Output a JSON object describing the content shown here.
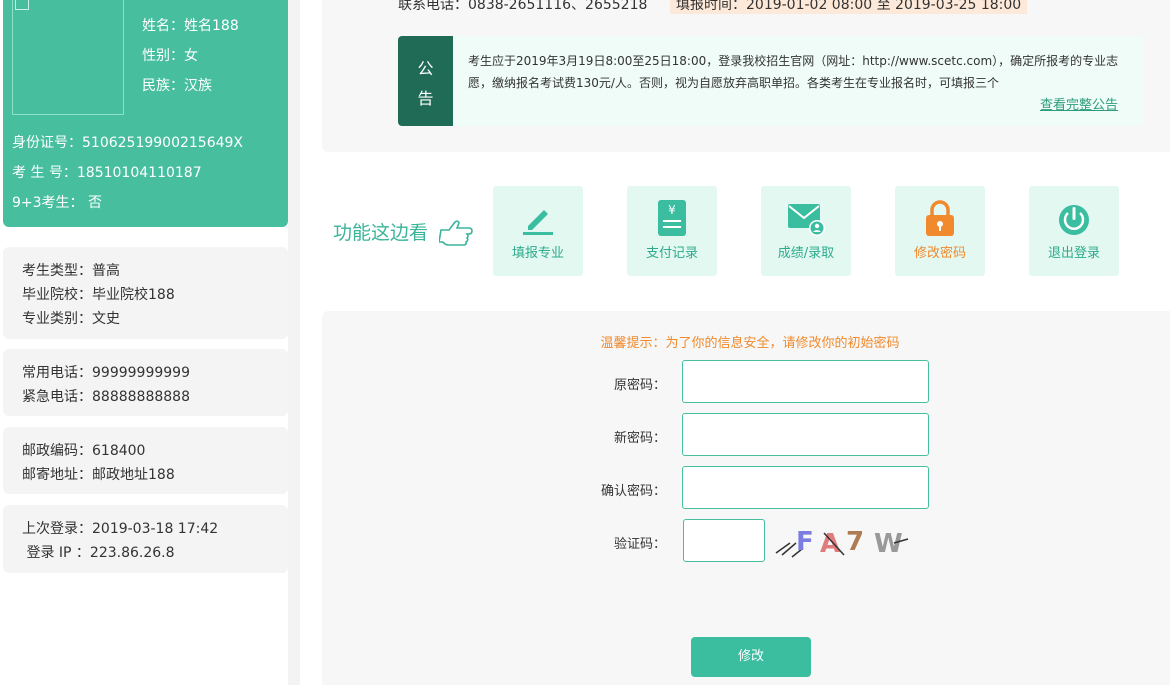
{
  "profile": {
    "name": "姓名：姓名188",
    "gender": "性别：女",
    "ethnicity": "民族：汉族",
    "id_number": "身份证号：51062519900215649X",
    "exam_number": "考 生 号：18510104110187",
    "nine_three": "9+3考生： 否"
  },
  "cards": {
    "exam_type": "考生类型：普高",
    "school": "毕业院校：毕业院校188",
    "category": "专业类别：文史",
    "phone": "常用电话：99999999999",
    "emergency": "紧急电话：88888888888",
    "postcode": "邮政编码：618400",
    "address": "邮寄地址：邮政地址188",
    "last_login": "上次登录：2019-03-18 17:42",
    "login_ip": " 登录 IP ：223.86.26.8"
  },
  "header": {
    "contact": "联系电话：0838-2651116、2655218",
    "fill_time": "填报时间：2019-01-02 08:00 至 2019-03-25 18:00"
  },
  "notice": {
    "tag_top": "公",
    "tag_bottom": "告",
    "text": "考生应于2019年3月19日8:00至25日18:00，登录我校招生官网（网址：http://www.scetc.com），确定所报考的专业志愿，缴纳报名考试费130元/人。否则，视为自愿放弃高职单招。各类考生在专业报名时，可填报三个",
    "link": "查看完整公告"
  },
  "functions": {
    "label": "功能这边看",
    "items": [
      {
        "label": "填报专业",
        "icon": "pencil-icon"
      },
      {
        "label": "支付记录",
        "icon": "receipt-icon"
      },
      {
        "label": "成绩/录取",
        "icon": "mail-user-icon"
      },
      {
        "label": "修改密码",
        "icon": "lock-icon"
      },
      {
        "label": "退出登录",
        "icon": "power-icon"
      }
    ]
  },
  "form": {
    "tip": "温馨提示：为了你的信息安全，请修改你的初始密码",
    "old_label": "原密码：",
    "new_label": "新密码：",
    "confirm_label": "确认密码：",
    "captcha_label": "验证码：",
    "captcha_text": "FA7W",
    "submit": "修改"
  },
  "colors": {
    "primary": "#47bf9f",
    "dark_green": "#1f6b55",
    "orange": "#f08a2c"
  }
}
